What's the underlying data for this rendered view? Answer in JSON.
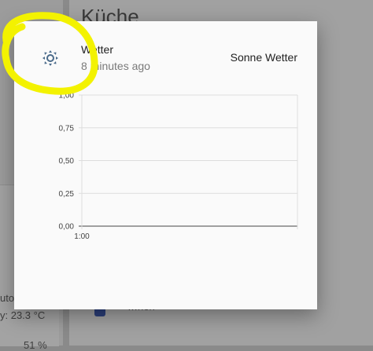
{
  "background": {
    "header": "Küche",
    "snippet1": "uto",
    "snippet2": "y: 23.3 °C",
    "snippet3": "51 %",
    "snippet4": "…hen"
  },
  "dialog": {
    "icon": "weather-sunny-icon",
    "title": "Wetter",
    "subtitle": "8 minutes ago",
    "state": "Sonne Wetter"
  },
  "chart_data": {
    "type": "line",
    "x_ticks": [
      "1:00"
    ],
    "y_ticks": [
      "1,00",
      "0,75",
      "0,50",
      "0,25",
      "0,00"
    ],
    "ylim": [
      0,
      1
    ],
    "series": [],
    "grid": true
  },
  "colors": {
    "highlight": "#f3f200",
    "icon": "#4a6a8a"
  }
}
